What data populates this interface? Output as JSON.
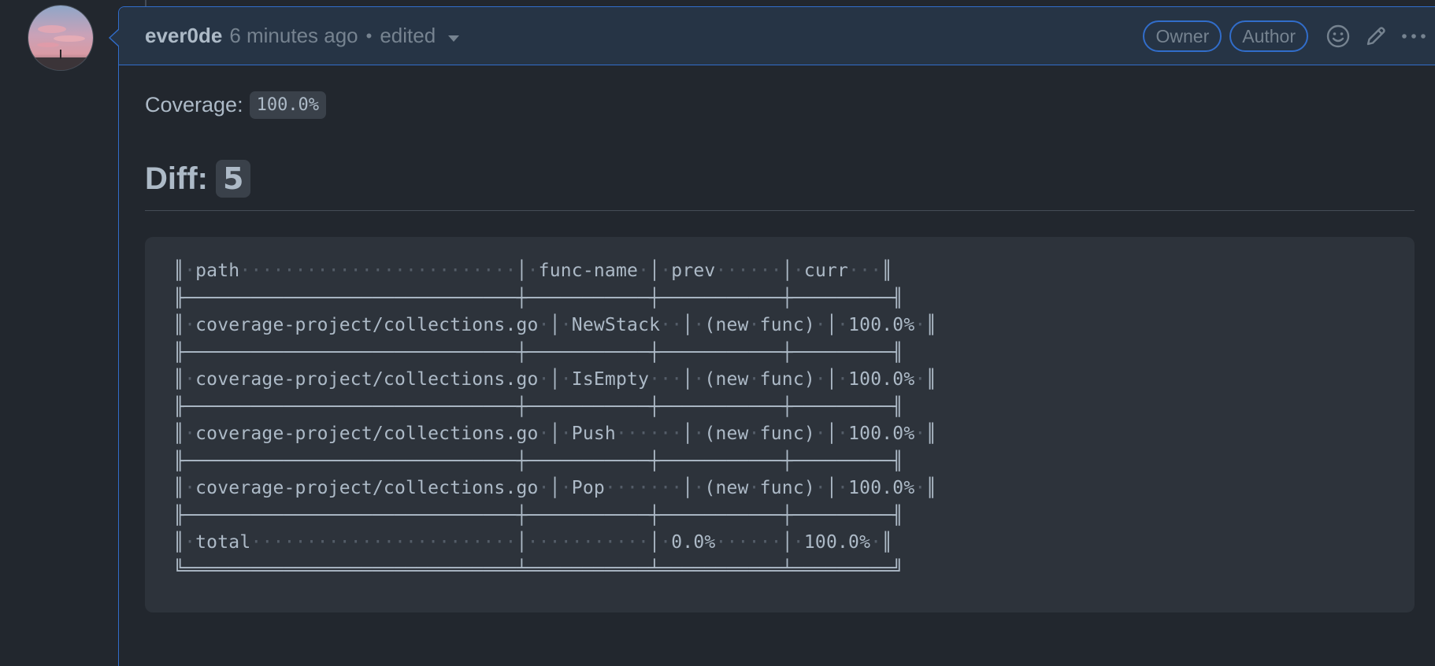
{
  "comment": {
    "author": "ever0de",
    "timestamp": "6 minutes ago",
    "separator": "•",
    "edited_label": "edited",
    "badges": [
      "Owner",
      "Author"
    ]
  },
  "body": {
    "coverage_label": "Coverage:",
    "coverage_value": "100.0%",
    "diff_label": "Diff:",
    "diff_count": "5",
    "table_text": "║·path·························│·func-name·│·prev······│·curr···║\n╟──────────────────────────────┼───────────┼───────────┼─────────╢\n║·coverage-project/collections.go·│·NewStack··│·(new·func)·│·100.0%·║\n╟──────────────────────────────┼───────────┼───────────┼─────────╢\n║·coverage-project/collections.go·│·IsEmpty···│·(new·func)·│·100.0%·║\n╟──────────────────────────────┼───────────┼───────────┼─────────╢\n║·coverage-project/collections.go·│·Push······│·(new·func)·│·100.0%·║\n╟──────────────────────────────┼───────────┼───────────┼─────────╢\n║·coverage-project/collections.go·│·Pop·······│·(new·func)·│·100.0%·║\n╟──────────────────────────────┼───────────┼───────────┼─────────╢\n║·total························│···········│·0.0%······│·100.0%·║\n╚══════════════════════════════╧═══════════╧═══════════╧═════════╝"
  },
  "icons": {
    "emoji": "smiley-icon",
    "edit": "pencil-icon",
    "more": "kebab-horizontal-icon",
    "caret": "triangle-down-icon"
  }
}
